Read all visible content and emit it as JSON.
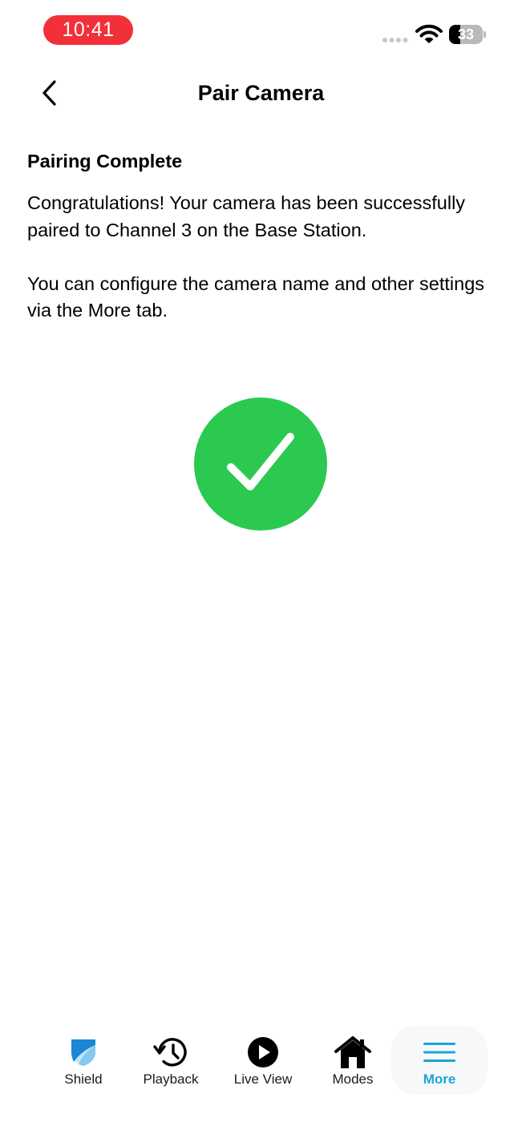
{
  "status_bar": {
    "time": "10:41",
    "battery_level": "33",
    "battery_fraction": 0.33
  },
  "header": {
    "title": "Pair Camera",
    "back_icon": "chevron-left-icon"
  },
  "content": {
    "heading": "Pairing Complete",
    "paragraphs": [
      "Congratulations! Your camera has been successfully paired to Channel 3 on the Base Station.",
      "You can configure the camera name and other settings via the More tab."
    ],
    "status_icon": "checkmark-icon"
  },
  "tab_bar": {
    "tabs": [
      {
        "label": "Shield",
        "icon": "shield-icon"
      },
      {
        "label": "Playback",
        "icon": "history-icon"
      },
      {
        "label": "Live View",
        "icon": "play-icon"
      },
      {
        "label": "Modes",
        "icon": "home-icon"
      },
      {
        "label": "More",
        "icon": "menu-icon",
        "active": true
      }
    ]
  },
  "colors": {
    "time_pill": "#f2303a",
    "success_green": "#2bc950",
    "accent_blue": "#1aa5d8"
  }
}
